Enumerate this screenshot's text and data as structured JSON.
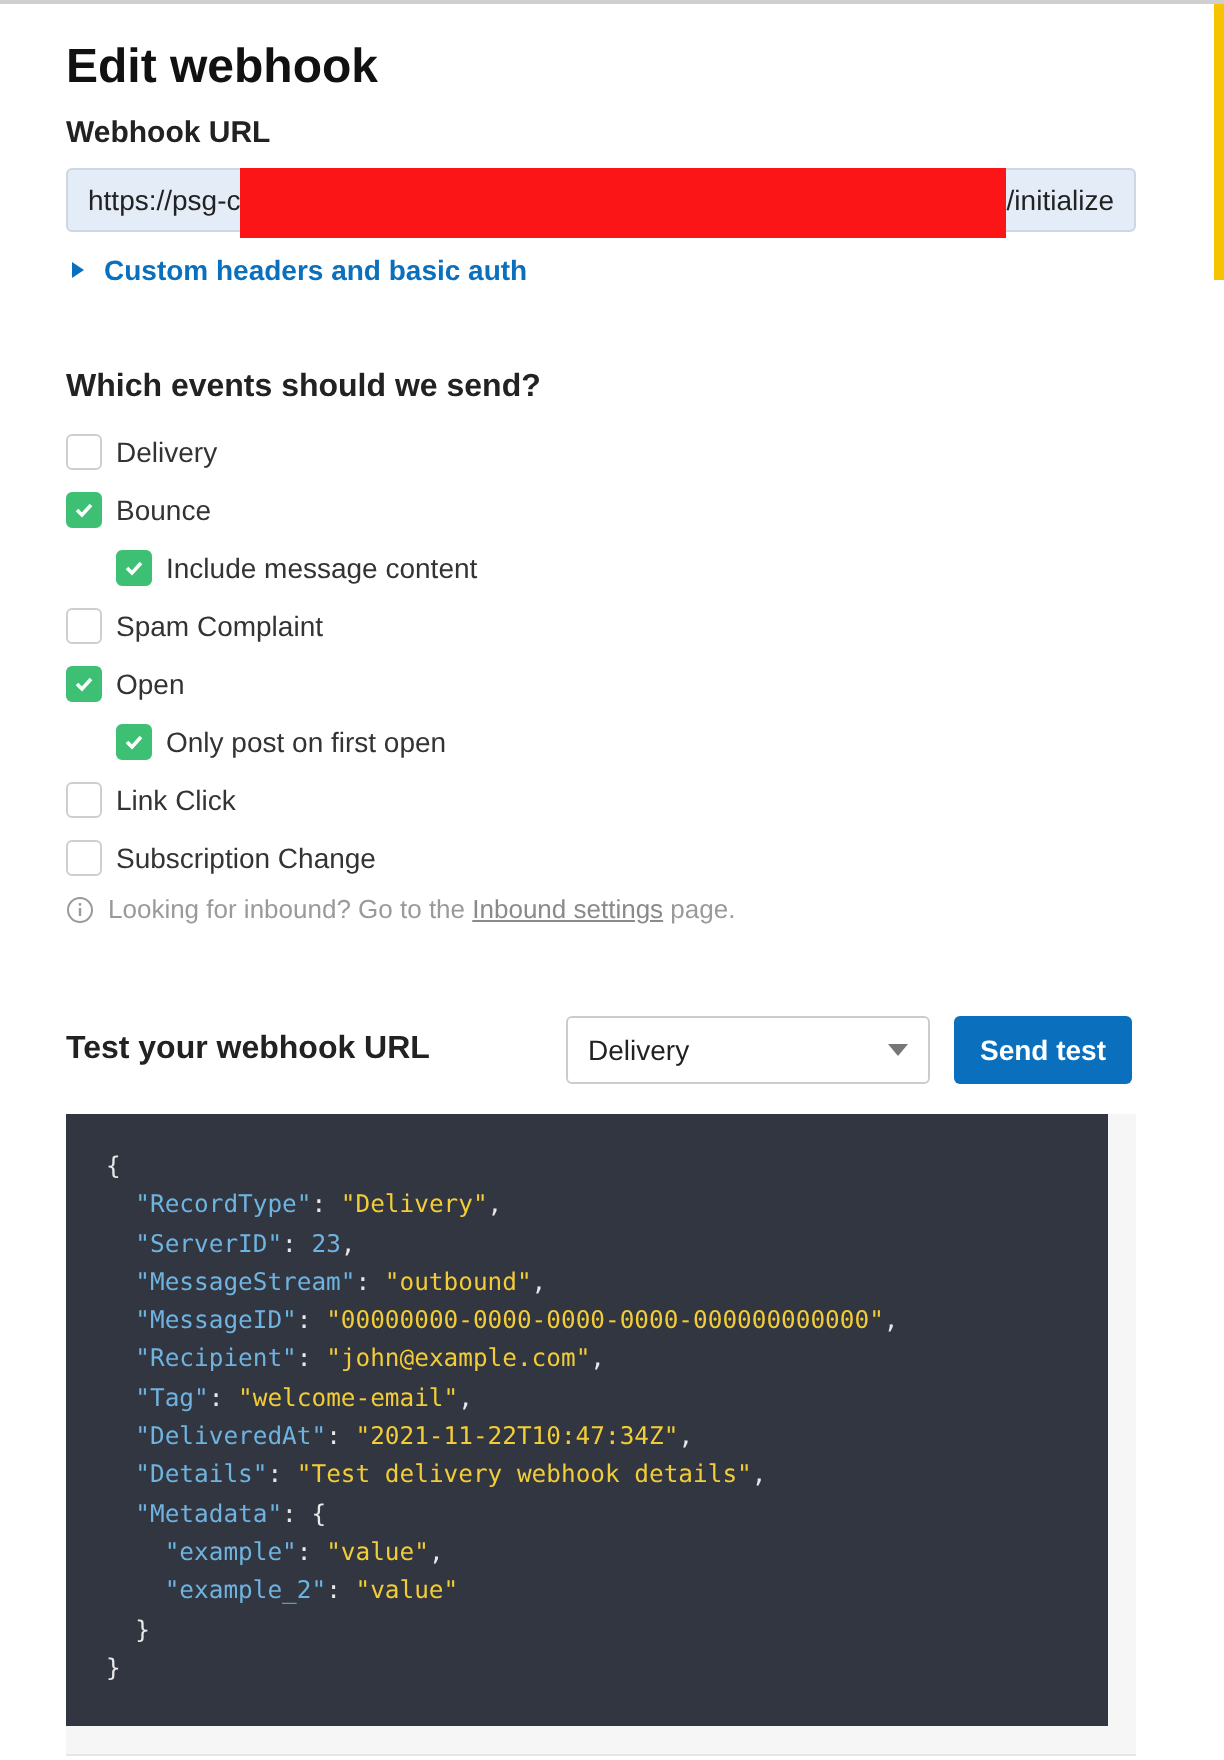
{
  "title": "Edit webhook",
  "url_label": "Webhook URL",
  "url_field": {
    "value_start": "https://psg-c",
    "value_end": "/initialize",
    "redacted": true
  },
  "custom_headers": {
    "label": "Custom headers and basic auth",
    "expanded": false
  },
  "events_heading": "Which events should we send?",
  "events": [
    {
      "label": "Delivery",
      "checked": false
    },
    {
      "label": "Bounce",
      "checked": true,
      "children": [
        {
          "label": "Include message content",
          "checked": true
        }
      ]
    },
    {
      "label": "Spam Complaint",
      "checked": false
    },
    {
      "label": "Open",
      "checked": true,
      "children": [
        {
          "label": "Only post on first open",
          "checked": true
        }
      ]
    },
    {
      "label": "Link Click",
      "checked": false
    },
    {
      "label": "Subscription Change",
      "checked": false
    }
  ],
  "inbound_note": {
    "before": "Looking for inbound? Go to the",
    "link": "Inbound settings",
    "after": "page."
  },
  "test_heading": "Test your webhook URL",
  "test_select": {
    "value": "Delivery"
  },
  "send_button": "Send test",
  "code": {
    "open": "{",
    "close": "}",
    "entries": [
      {
        "key": "\"RecordType\"",
        "sep": ":",
        "value": "\"Delivery\"",
        "kind": "string",
        "trail": ","
      },
      {
        "key": "\"ServerID\"",
        "sep": ":",
        "value": "23",
        "kind": "number",
        "trail": ","
      },
      {
        "key": "\"MessageStream\"",
        "sep": ":",
        "value": "\"outbound\"",
        "kind": "string",
        "trail": ","
      },
      {
        "key": "\"MessageID\"",
        "sep": ":",
        "value": "\"00000000-0000-0000-0000-000000000000\"",
        "kind": "string",
        "trail": ","
      },
      {
        "key": "\"Recipient\"",
        "sep": ":",
        "value": "\"john@example.com\"",
        "kind": "string",
        "trail": ","
      },
      {
        "key": "\"Tag\"",
        "sep": ":",
        "value": "\"welcome-email\"",
        "kind": "string",
        "trail": ","
      },
      {
        "key": "\"DeliveredAt\"",
        "sep": ":",
        "value": "\"2021-11-22T10:47:34Z\"",
        "kind": "string",
        "trail": ","
      },
      {
        "key": "\"Details\"",
        "sep": ":",
        "value": "\"Test delivery webhook details\"",
        "kind": "string",
        "trail": ","
      },
      {
        "key": "\"Metadata\"",
        "sep": ":",
        "value": "{",
        "kind": "object",
        "close": "}",
        "children": [
          {
            "key": "\"example\"",
            "sep": ":",
            "value": "\"value\"",
            "kind": "string",
            "trail": ","
          },
          {
            "key": "\"example_2\"",
            "sep": ":",
            "value": "\"value\"",
            "kind": "string"
          }
        ]
      }
    ]
  }
}
